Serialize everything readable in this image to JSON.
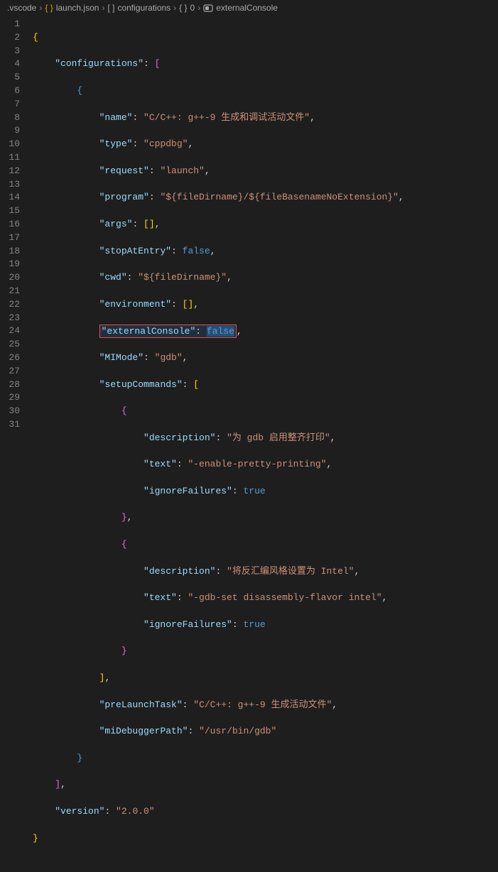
{
  "breadcrumb": {
    "items": [
      {
        "label": ".vscode",
        "icon": null
      },
      {
        "label": "launch.json",
        "icon": "json-brace"
      },
      {
        "label": "configurations",
        "icon": "array"
      },
      {
        "label": "0",
        "icon": "object"
      },
      {
        "label": "externalConsole",
        "icon": "boolean"
      }
    ]
  },
  "code": {
    "line1": "{",
    "key_configurations": "\"configurations\"",
    "key_name": "\"name\"",
    "val_name": "\"C/C++: g++-9 生成和调试活动文件\"",
    "key_type": "\"type\"",
    "val_type": "\"cppdbg\"",
    "key_request": "\"request\"",
    "val_request": "\"launch\"",
    "key_program": "\"program\"",
    "val_program": "\"${fileDirname}/${fileBasenameNoExtension}\"",
    "key_args": "\"args\"",
    "key_stopAtEntry": "\"stopAtEntry\"",
    "val_false": "false",
    "key_cwd": "\"cwd\"",
    "val_cwd": "\"${fileDirname}\"",
    "key_environment": "\"environment\"",
    "key_externalConsole": "\"externalConsole\"",
    "val_externalConsole": "·false",
    "key_MIMode": "\"MIMode\"",
    "val_MIMode": "\"gdb\"",
    "key_setupCommands": "\"setupCommands\"",
    "key_description": "\"description\"",
    "val_desc1": "\"为 gdb 启用整齐打印\"",
    "key_text": "\"text\"",
    "val_text1": "\"-enable-pretty-printing\"",
    "key_ignoreFailures": "\"ignoreFailures\"",
    "val_true": "true",
    "val_desc2": "\"将反汇编风格设置为 Intel\"",
    "val_text2": "\"-gdb-set disassembly-flavor intel\"",
    "key_preLaunchTask": "\"preLaunchTask\"",
    "val_preLaunchTask": "\"C/C++: g++-9 生成活动文件\"",
    "key_miDebuggerPath": "\"miDebuggerPath\"",
    "val_miDebuggerPath": "\"/usr/bin/gdb\"",
    "key_version": "\"version\"",
    "val_version": "\"2.0.0\""
  },
  "line_count": 31,
  "highlighted_line": 12
}
